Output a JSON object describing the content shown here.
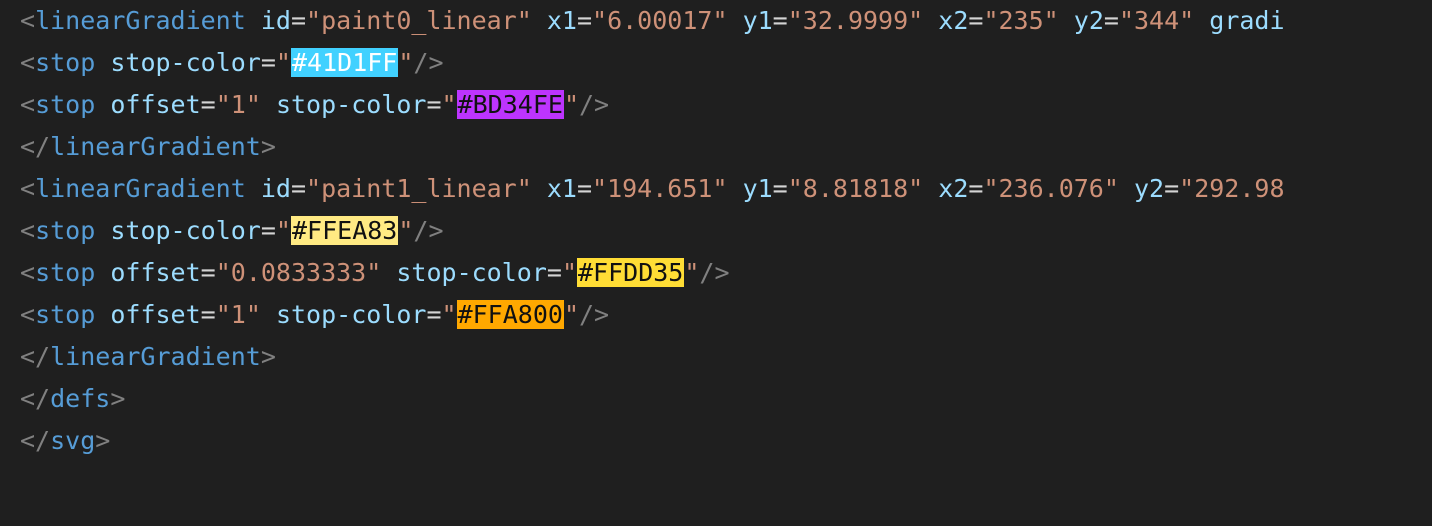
{
  "editor": {
    "background": "#1f1f1f",
    "lines": [
      {
        "segments": [
          {
            "text": "<",
            "type": "punct"
          },
          {
            "text": "linearGradient",
            "type": "tag"
          },
          {
            "text": " ",
            "type": "plain"
          },
          {
            "text": "id",
            "type": "attr"
          },
          {
            "text": "=",
            "type": "eq"
          },
          {
            "text": "\"paint0_linear\"",
            "type": "str"
          },
          {
            "text": " ",
            "type": "plain"
          },
          {
            "text": "x1",
            "type": "attr"
          },
          {
            "text": "=",
            "type": "eq"
          },
          {
            "text": "\"6.00017\"",
            "type": "str"
          },
          {
            "text": " ",
            "type": "plain"
          },
          {
            "text": "y1",
            "type": "attr"
          },
          {
            "text": "=",
            "type": "eq"
          },
          {
            "text": "\"32.9999\"",
            "type": "str"
          },
          {
            "text": " ",
            "type": "plain"
          },
          {
            "text": "x2",
            "type": "attr"
          },
          {
            "text": "=",
            "type": "eq"
          },
          {
            "text": "\"235\"",
            "type": "str"
          },
          {
            "text": " ",
            "type": "plain"
          },
          {
            "text": "y2",
            "type": "attr"
          },
          {
            "text": "=",
            "type": "eq"
          },
          {
            "text": "\"344\"",
            "type": "str"
          },
          {
            "text": " ",
            "type": "plain"
          },
          {
            "text": "gradi",
            "type": "attr"
          }
        ]
      },
      {
        "segments": [
          {
            "text": "<",
            "type": "punct"
          },
          {
            "text": "stop",
            "type": "tag"
          },
          {
            "text": " ",
            "type": "plain"
          },
          {
            "text": "stop-color",
            "type": "attr"
          },
          {
            "text": "=",
            "type": "eq"
          },
          {
            "text": "\"",
            "type": "str"
          },
          {
            "text": "#41D1FF",
            "type": "swatch",
            "color": "#41D1FF",
            "light": true
          },
          {
            "text": "\"",
            "type": "str"
          },
          {
            "text": "/>",
            "type": "punct"
          }
        ]
      },
      {
        "segments": [
          {
            "text": "<",
            "type": "punct"
          },
          {
            "text": "stop",
            "type": "tag"
          },
          {
            "text": " ",
            "type": "plain"
          },
          {
            "text": "offset",
            "type": "attr"
          },
          {
            "text": "=",
            "type": "eq"
          },
          {
            "text": "\"1\"",
            "type": "str"
          },
          {
            "text": " ",
            "type": "plain"
          },
          {
            "text": "stop-color",
            "type": "attr"
          },
          {
            "text": "=",
            "type": "eq"
          },
          {
            "text": "\"",
            "type": "str"
          },
          {
            "text": "#BD34FE",
            "type": "swatch",
            "color": "#BD34FE",
            "light": false
          },
          {
            "text": "\"",
            "type": "str"
          },
          {
            "text": "/>",
            "type": "punct"
          }
        ]
      },
      {
        "segments": [
          {
            "text": "</",
            "type": "punct"
          },
          {
            "text": "linearGradient",
            "type": "tag"
          },
          {
            "text": ">",
            "type": "punct"
          }
        ]
      },
      {
        "segments": [
          {
            "text": "<",
            "type": "punct"
          },
          {
            "text": "linearGradient",
            "type": "tag"
          },
          {
            "text": " ",
            "type": "plain"
          },
          {
            "text": "id",
            "type": "attr"
          },
          {
            "text": "=",
            "type": "eq"
          },
          {
            "text": "\"paint1_linear\"",
            "type": "str"
          },
          {
            "text": " ",
            "type": "plain"
          },
          {
            "text": "x1",
            "type": "attr"
          },
          {
            "text": "=",
            "type": "eq"
          },
          {
            "text": "\"194.651\"",
            "type": "str"
          },
          {
            "text": " ",
            "type": "plain"
          },
          {
            "text": "y1",
            "type": "attr"
          },
          {
            "text": "=",
            "type": "eq"
          },
          {
            "text": "\"8.81818\"",
            "type": "str"
          },
          {
            "text": " ",
            "type": "plain"
          },
          {
            "text": "x2",
            "type": "attr"
          },
          {
            "text": "=",
            "type": "eq"
          },
          {
            "text": "\"236.076\"",
            "type": "str"
          },
          {
            "text": " ",
            "type": "plain"
          },
          {
            "text": "y2",
            "type": "attr"
          },
          {
            "text": "=",
            "type": "eq"
          },
          {
            "text": "\"292.98",
            "type": "str"
          }
        ]
      },
      {
        "segments": [
          {
            "text": "<",
            "type": "punct"
          },
          {
            "text": "stop",
            "type": "tag"
          },
          {
            "text": " ",
            "type": "plain"
          },
          {
            "text": "stop-color",
            "type": "attr"
          },
          {
            "text": "=",
            "type": "eq"
          },
          {
            "text": "\"",
            "type": "str"
          },
          {
            "text": "#FFEA83",
            "type": "swatch",
            "color": "#FFEA83",
            "light": false
          },
          {
            "text": "\"",
            "type": "str"
          },
          {
            "text": "/>",
            "type": "punct"
          }
        ]
      },
      {
        "segments": [
          {
            "text": "<",
            "type": "punct"
          },
          {
            "text": "stop",
            "type": "tag"
          },
          {
            "text": " ",
            "type": "plain"
          },
          {
            "text": "offset",
            "type": "attr"
          },
          {
            "text": "=",
            "type": "eq"
          },
          {
            "text": "\"0.0833333\"",
            "type": "str"
          },
          {
            "text": " ",
            "type": "plain"
          },
          {
            "text": "stop-color",
            "type": "attr"
          },
          {
            "text": "=",
            "type": "eq"
          },
          {
            "text": "\"",
            "type": "str"
          },
          {
            "text": "#FFDD35",
            "type": "swatch",
            "color": "#FFDD35",
            "light": false
          },
          {
            "text": "\"",
            "type": "str"
          },
          {
            "text": "/>",
            "type": "punct"
          }
        ]
      },
      {
        "segments": [
          {
            "text": "<",
            "type": "punct"
          },
          {
            "text": "stop",
            "type": "tag"
          },
          {
            "text": " ",
            "type": "plain"
          },
          {
            "text": "offset",
            "type": "attr"
          },
          {
            "text": "=",
            "type": "eq"
          },
          {
            "text": "\"1\"",
            "type": "str"
          },
          {
            "text": " ",
            "type": "plain"
          },
          {
            "text": "stop-color",
            "type": "attr"
          },
          {
            "text": "=",
            "type": "eq"
          },
          {
            "text": "\"",
            "type": "str"
          },
          {
            "text": "#FFA800",
            "type": "swatch",
            "color": "#FFA800",
            "light": false
          },
          {
            "text": "\"",
            "type": "str"
          },
          {
            "text": "/>",
            "type": "punct"
          }
        ]
      },
      {
        "segments": [
          {
            "text": "</",
            "type": "punct"
          },
          {
            "text": "linearGradient",
            "type": "tag"
          },
          {
            "text": ">",
            "type": "punct"
          }
        ]
      },
      {
        "segments": [
          {
            "text": "</",
            "type": "punct"
          },
          {
            "text": "defs",
            "type": "tag"
          },
          {
            "text": ">",
            "type": "punct"
          }
        ]
      },
      {
        "segments": [
          {
            "text": "</",
            "type": "punct"
          },
          {
            "text": "svg",
            "type": "tag"
          },
          {
            "text": ">",
            "type": "punct"
          }
        ]
      }
    ]
  }
}
